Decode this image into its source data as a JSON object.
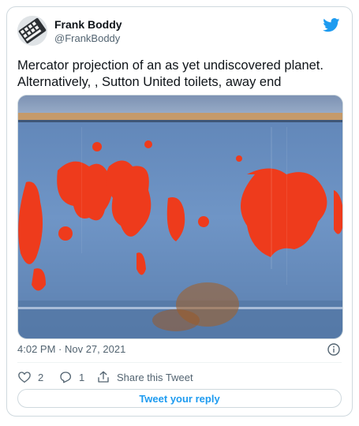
{
  "author": {
    "name": "Frank Boddy",
    "handle": "@FrankBoddy"
  },
  "tweet": {
    "text_line_1": "Mercator projection of an as yet undiscovered planet.",
    "text_line_2": "Alternatively, , Sutton United toilets, away end"
  },
  "meta": {
    "timestamp": "4:02 PM · Nov 27, 2021"
  },
  "actions": {
    "like_count": "2",
    "reply_count": "1",
    "share_label": "Share this Tweet"
  },
  "reply_button_label": "Tweet your reply",
  "colors": {
    "brand_blue": "#1d9bf0",
    "text_primary": "#0f1419",
    "text_secondary": "#536471",
    "border": "#cfd9de"
  },
  "icons": {
    "logo": "twitter-bird-icon",
    "info": "info-icon",
    "like": "heart-icon",
    "reply": "reply-icon",
    "share": "share-icon"
  }
}
